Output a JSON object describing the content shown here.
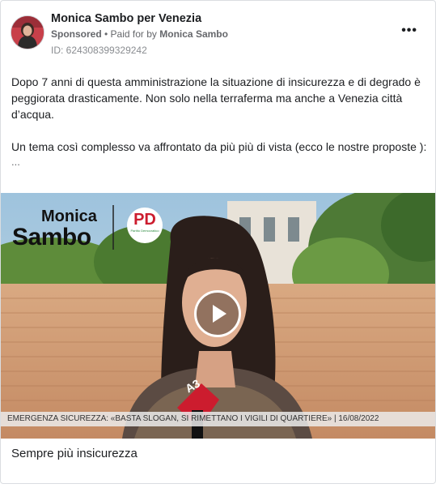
{
  "post": {
    "author": "Monica Sambo per Venezia",
    "sponsored_label": "Sponsored",
    "paid_prefix": "• Paid for by",
    "payer": "Monica Sambo",
    "ad_id": "ID: 624308399329242",
    "more_icon": "more-horizontal-icon",
    "more_label": "•••",
    "paragraph1": "Dopo 7 anni di questa amministrazione la situazione di insicurezza e di degrado è peggiorata drasticamente. Non solo nella terraferma ma anche a Venezia città d’acqua.",
    "paragraph2": "Un tema così complesso va affrontato da più più di vista (ecco le nostre proposte ):",
    "ellipsis": "...",
    "caption": "Sempre più insicurezza"
  },
  "video": {
    "logo_line1": "Monica",
    "logo_line2": "Sambo",
    "party_logo_text": "PD",
    "party_logo_sub": "Partito Democratico",
    "mic_logo": "A3",
    "ticker": "EMERGENZA SICUREZZA: «BASTA SLOGAN, SI RIMETTANO I VIGILI DI QUARTIERE» | 16/08/2022",
    "play_icon": "play-icon"
  }
}
